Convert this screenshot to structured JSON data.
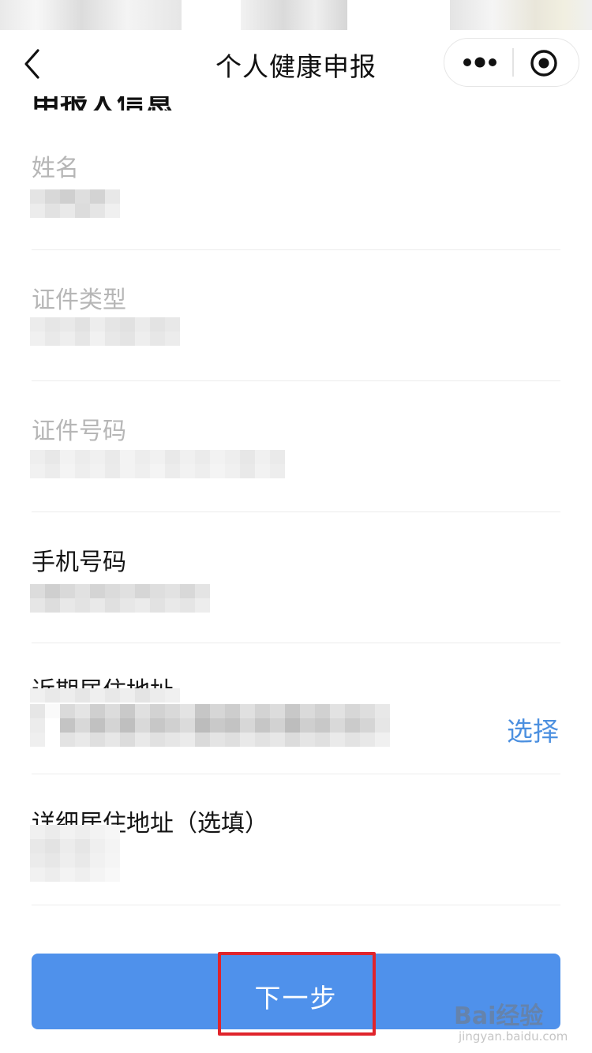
{
  "nav": {
    "title": "个人健康申报",
    "back_icon": "chevron-left-icon",
    "more_icon": "more-dots-icon",
    "close_icon": "miniprogram-close-icon"
  },
  "section": {
    "heading": "申报人信息"
  },
  "form": {
    "fields": [
      {
        "label": "姓名",
        "style": "placeholder"
      },
      {
        "label": "证件类型",
        "style": "placeholder"
      },
      {
        "label": "证件号码",
        "style": "placeholder"
      },
      {
        "label": "手机号码",
        "style": "filled"
      },
      {
        "label": "近期居住地址",
        "style": "filled",
        "action": "选择"
      },
      {
        "label": "详细居住地址（选填）",
        "style": "filled"
      }
    ]
  },
  "buttons": {
    "next_label": "下一步"
  },
  "watermark": {
    "brand": "Bai经验",
    "sub": "jingyan.baidu.com"
  },
  "colors": {
    "primary": "#4f91eb",
    "link": "#4c90e0",
    "highlight": "#e0242b"
  }
}
